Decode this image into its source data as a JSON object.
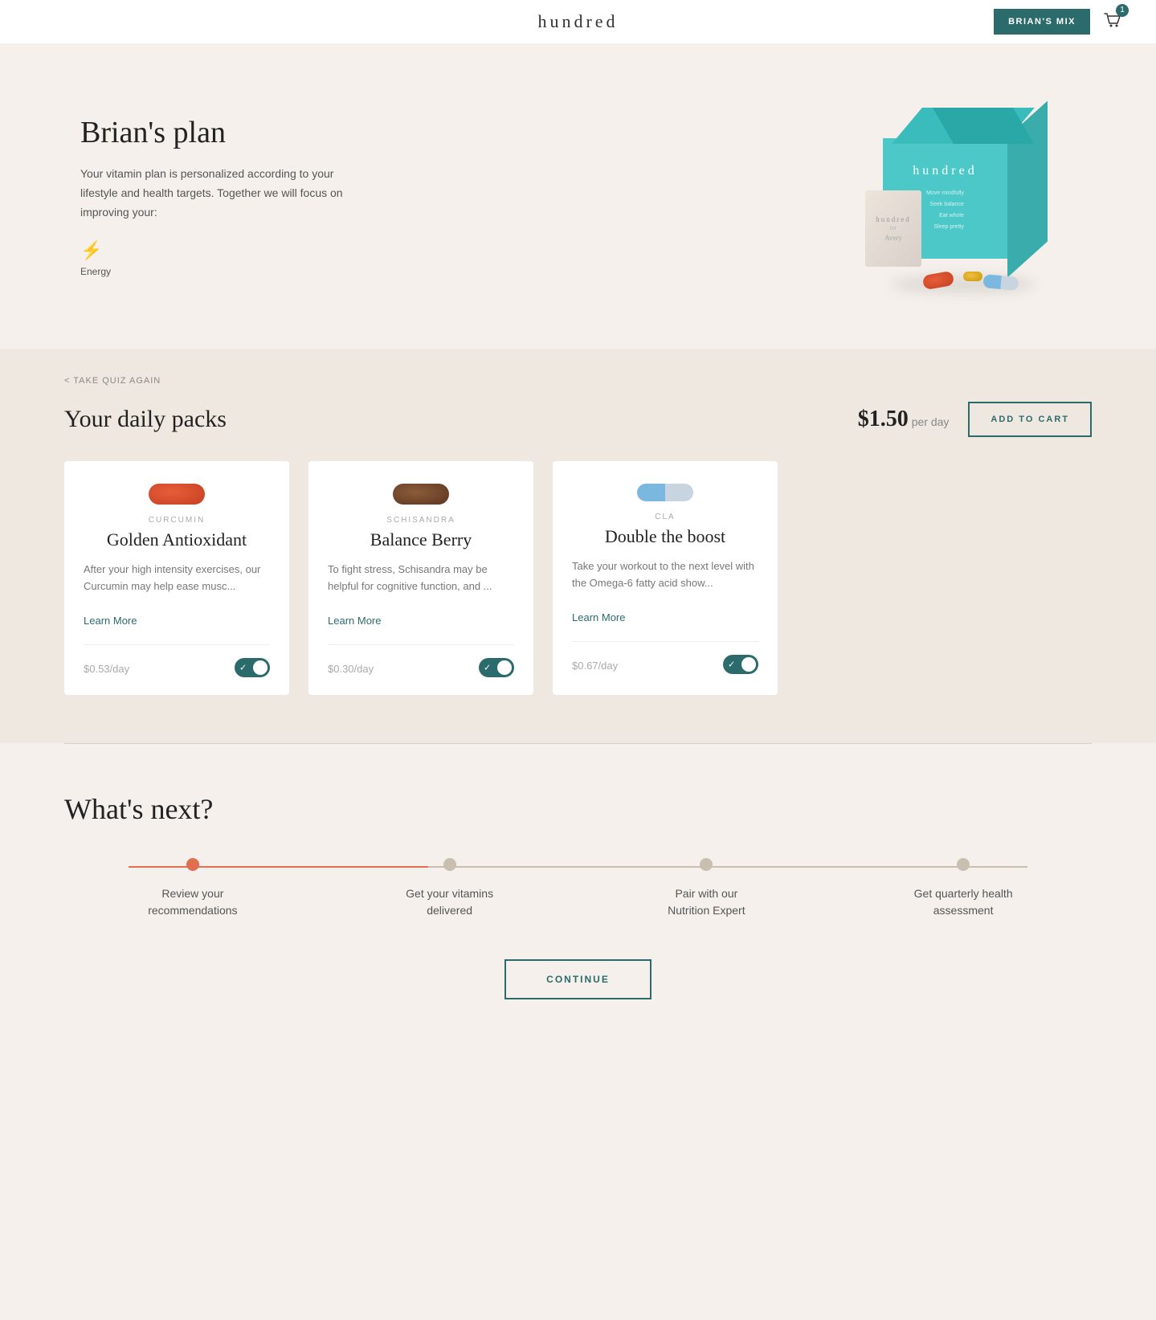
{
  "header": {
    "logo": "hundred",
    "brian_mix_label": "BRIAN'S MIX",
    "cart_count": "1"
  },
  "hero": {
    "title": "Brian's plan",
    "description": "Your vitamin plan is personalized according to your lifestyle and health targets. Together we will focus on improving your:",
    "focus_label": "Energy",
    "box_brand": "hundred",
    "box_lines": [
      "Move mindfully",
      "Seek balance",
      "Eat whole",
      "Sleep pretty"
    ],
    "packet_label": "hundred"
  },
  "daily_packs": {
    "quiz_link": "< TAKE QUIZ AGAIN",
    "title": "Your daily packs",
    "price": "$1.50",
    "price_unit": "per day",
    "add_to_cart": "ADD TO CART",
    "cards": [
      {
        "subtitle": "CURCUMIN",
        "name": "Golden Antioxidant",
        "description": "After your high intensity exercises, our Curcumin may help ease musc...",
        "learn_more": "Learn More",
        "price": "$0.53",
        "price_unit": "/day",
        "toggle_on": true,
        "pill_type": "curcumin"
      },
      {
        "subtitle": "SCHISANDRA",
        "name": "Balance Berry",
        "description": "To fight stress, Schisandra may be helpful for cognitive function, and ...",
        "learn_more": "Learn More",
        "price": "$0.30",
        "price_unit": "/day",
        "toggle_on": true,
        "pill_type": "schisandra"
      },
      {
        "subtitle": "CLA",
        "name": "Double the boost",
        "description": "Take your workout to the next level with the Omega-6 fatty acid show...",
        "learn_more": "Learn More",
        "price": "$0.67",
        "price_unit": "/day",
        "toggle_on": true,
        "pill_type": "cla"
      }
    ]
  },
  "whats_next": {
    "title": "What's next?",
    "steps": [
      {
        "label": "Review your recommendations",
        "active": true
      },
      {
        "label": "Get your vitamins delivered",
        "active": false
      },
      {
        "label": "Pair with our Nutrition Expert",
        "active": false
      },
      {
        "label": "Get quarterly health assessment",
        "active": false
      }
    ],
    "continue_label": "CONTINUE"
  }
}
